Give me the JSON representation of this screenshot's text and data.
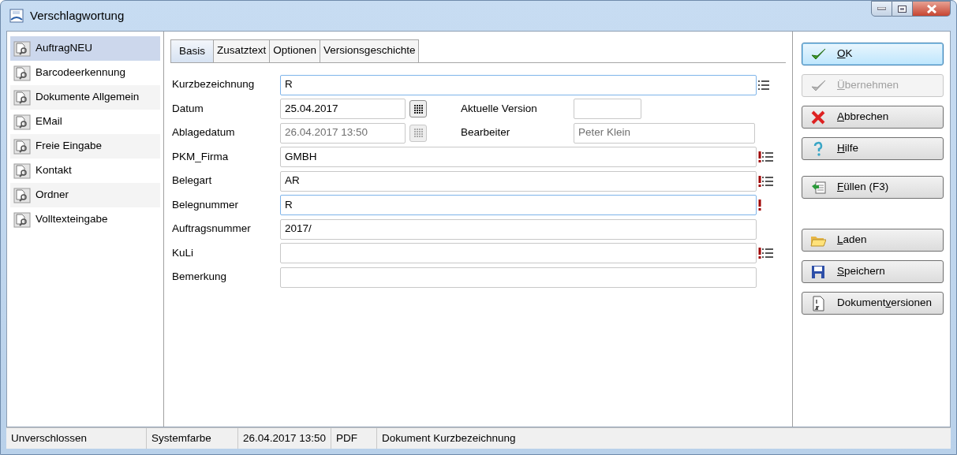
{
  "window": {
    "title": "Verschlagwortung"
  },
  "sidebar": {
    "items": [
      {
        "label": "AuftragNEU",
        "selected": true
      },
      {
        "label": "Barcodeerkennung",
        "selected": false
      },
      {
        "label": "Dokumente Allgemein",
        "selected": false
      },
      {
        "label": "EMail",
        "selected": false
      },
      {
        "label": "Freie Eingabe",
        "selected": false
      },
      {
        "label": "Kontakt",
        "selected": false
      },
      {
        "label": "Ordner",
        "selected": false
      },
      {
        "label": "Volltexteingabe",
        "selected": false
      }
    ]
  },
  "tabs": [
    {
      "label": "Basis",
      "selected": true
    },
    {
      "label": "Zusatztext",
      "selected": false
    },
    {
      "label": "Optionen",
      "selected": false
    },
    {
      "label": "Versionsgeschichte",
      "selected": false
    }
  ],
  "fields": [
    {
      "kind": "text",
      "label": "Kurzbezeichnung",
      "value": "R",
      "focused": true,
      "required": false,
      "has_list": true
    },
    {
      "kind": "date",
      "label": "Datum",
      "value": "25.04.2017",
      "disabled": false,
      "side_label": "Aktuelle Version",
      "side_short": true
    },
    {
      "kind": "date",
      "label": "Ablagedatum",
      "value": "26.04.2017 13:50",
      "disabled": true,
      "side_label": "Bearbeiter",
      "side_value": "Peter Klein",
      "side_short": false
    },
    {
      "kind": "text",
      "label": "PKM_Firma",
      "value": "GMBH",
      "focused": false,
      "required": true,
      "has_list": true
    },
    {
      "kind": "text",
      "label": "Belegart",
      "value": "AR",
      "focused": false,
      "required": true,
      "has_list": true
    },
    {
      "kind": "text",
      "label": "Belegnummer",
      "value": "R",
      "focused": true,
      "required": true,
      "has_list": false
    },
    {
      "kind": "text",
      "label": "Auftragsnummer",
      "value": "2017/",
      "focused": false,
      "required": false,
      "has_list": false
    },
    {
      "kind": "text",
      "label": "KuLi",
      "focused": false,
      "required": true,
      "has_list": true
    },
    {
      "kind": "text",
      "label": "Bemerkung",
      "focused": false,
      "required": false,
      "has_list": false
    }
  ],
  "button_groups": [
    {
      "buttons": [
        {
          "key": "O",
          "post": "K",
          "disabled": false,
          "default": true
        },
        {
          "key": "Ü",
          "post": "bernehmen",
          "disabled": true,
          "default": false
        },
        {
          "key": "A",
          "post": "bbrechen",
          "disabled": false,
          "default": false
        },
        {
          "key": "H",
          "post": "ilfe",
          "disabled": false,
          "default": false
        }
      ]
    },
    {
      "buttons": [
        {
          "key": "F",
          "post": "üllen (F3)",
          "disabled": false,
          "default": false
        }
      ]
    },
    {
      "buttons": [
        {
          "key": "L",
          "post": "aden",
          "disabled": false,
          "default": false
        },
        {
          "key": "S",
          "post": "peichern",
          "disabled": false,
          "default": false
        },
        {
          "pre": "Dokument",
          "key": "v",
          "post": "ersionen",
          "disabled": false,
          "default": false
        }
      ]
    }
  ],
  "status_bar": [
    "Unverschlossen",
    "Systemfarbe",
    "26.04.2017 13:50",
    "PDF",
    "Dokument Kurzbezeichnung"
  ]
}
